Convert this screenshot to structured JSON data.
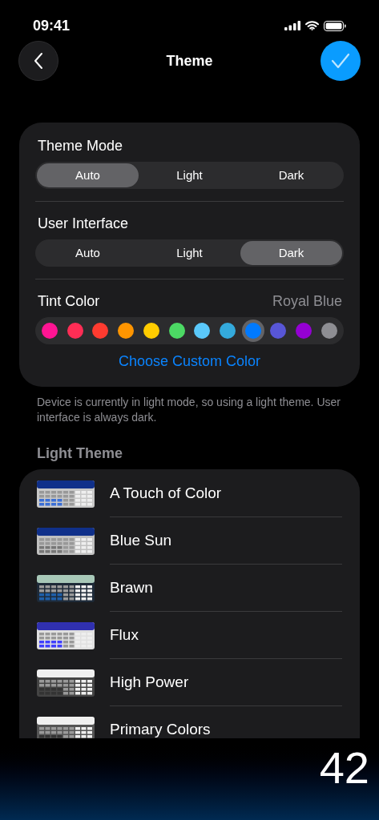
{
  "status_bar": {
    "time": "09:41"
  },
  "nav": {
    "title": "Theme"
  },
  "settings": [
    {
      "kind": "segmented",
      "label": "Theme Mode",
      "options": [
        {
          "label": "Auto",
          "selected": true
        },
        {
          "label": "Light",
          "selected": false
        },
        {
          "label": "Dark",
          "selected": false
        }
      ]
    },
    {
      "kind": "segmented",
      "label": "User Interface",
      "options": [
        {
          "label": "Auto",
          "selected": false
        },
        {
          "label": "Light",
          "selected": false
        },
        {
          "label": "Dark",
          "selected": true
        }
      ]
    },
    {
      "kind": "swatches",
      "label": "Tint Color",
      "value": "Royal Blue",
      "swatches": [
        {
          "color": "#ff1493",
          "selected": false
        },
        {
          "color": "#ff2d55",
          "selected": false
        },
        {
          "color": "#ff3b30",
          "selected": false
        },
        {
          "color": "#ff9500",
          "selected": false
        },
        {
          "color": "#ffcc00",
          "selected": false
        },
        {
          "color": "#4cd964",
          "selected": false
        },
        {
          "color": "#5ac8fa",
          "selected": false
        },
        {
          "color": "#34aadc",
          "selected": false
        },
        {
          "color": "#007aff",
          "selected": true
        },
        {
          "color": "#5856d6",
          "selected": false
        },
        {
          "color": "#9400d3",
          "selected": false
        },
        {
          "color": "#8e8e93",
          "selected": false
        }
      ],
      "link": "Choose Custom Color"
    }
  ],
  "footnote": "Device is currently in light mode, so using a light theme. User interface is always dark.",
  "light_theme": {
    "header": "Light Theme",
    "items": [
      {
        "name": "A Touch of Color"
      },
      {
        "name": "Blue Sun"
      },
      {
        "name": "Brawn"
      },
      {
        "name": "Flux"
      },
      {
        "name": "High Power"
      },
      {
        "name": "Primary Colors"
      }
    ]
  },
  "display": {
    "value": "42"
  }
}
